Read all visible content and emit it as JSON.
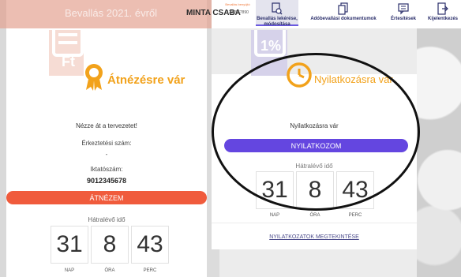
{
  "topbar": {
    "title": "Bevallás 2021. évről",
    "user_name": "MINTA CSABA",
    "id_label": "Bevallás benyújtó",
    "id_number": "1234567890",
    "nav": [
      {
        "label_line1": "Bevallás lekérése,",
        "label_line2": "módosítása",
        "icon": "document-search-icon"
      },
      {
        "label_line1": "Adóbevallási dokumentumok",
        "label_line2": "",
        "icon": "documents-icon"
      },
      {
        "label_line1": "Értesítések",
        "label_line2": "",
        "icon": "notification-icon"
      },
      {
        "label_line1": "Kijelentkezés",
        "label_line2": "",
        "icon": "logout-icon"
      }
    ]
  },
  "left_card": {
    "status": "Átnézésre vár",
    "instruction": "Nézze át a tervezetet!",
    "arrival_label": "Érkeztetési szám:",
    "arrival_value": "-",
    "filing_label": "Iktatószám:",
    "filing_value": "9012345678",
    "button": "ÁTNÉZEM",
    "remaining_label": "Hátralévő idő",
    "timer": [
      {
        "value": "31",
        "unit": "NAP"
      },
      {
        "value": "8",
        "unit": "ÓRA"
      },
      {
        "value": "43",
        "unit": "PERC"
      }
    ]
  },
  "right_card": {
    "status": "Nyilatkozásra vár",
    "status_text": "Nyilatkozásra vár",
    "button": "NYILATKOZOM",
    "remaining_label": "Hátralévő idő",
    "timer": [
      {
        "value": "31",
        "unit": "NAP"
      },
      {
        "value": "8",
        "unit": "ÓRA"
      },
      {
        "value": "43",
        "unit": "PERC"
      }
    ],
    "link": "NYILATKOZATOK MEGTEKINTÉSE"
  },
  "colors": {
    "orange": "#f05b3c",
    "purple": "#6446e0",
    "badge": "#f2a21b"
  }
}
